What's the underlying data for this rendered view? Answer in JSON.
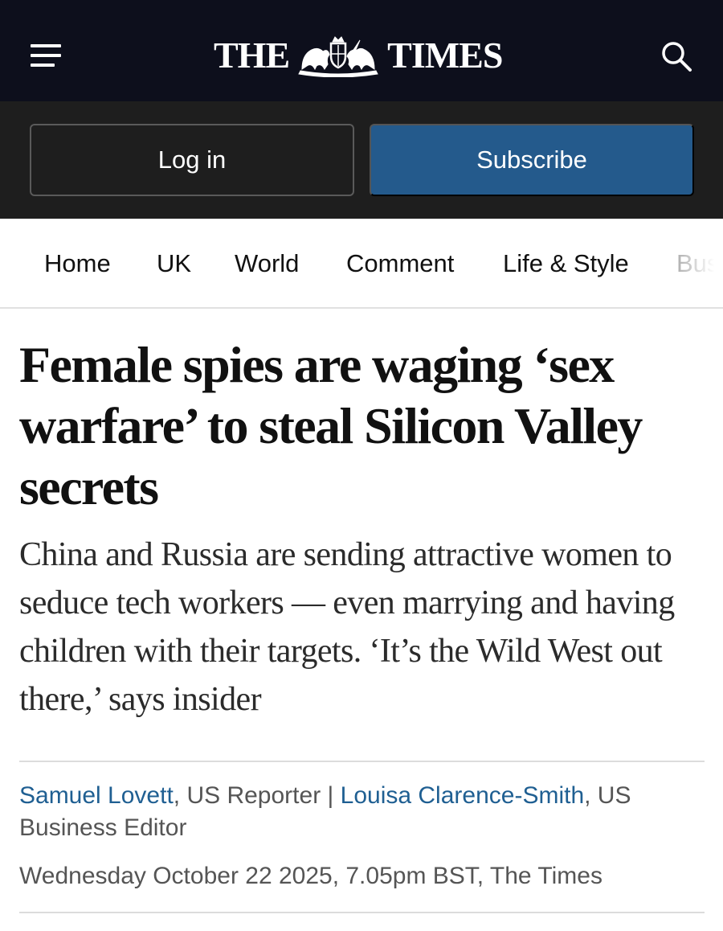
{
  "header": {
    "masthead_left": "THE",
    "masthead_right": "TIMES",
    "crest_icon": "royal-crest-icon",
    "menu_icon": "hamburger-menu-icon",
    "search_icon": "search-icon",
    "background": "#0d0f1c"
  },
  "auth": {
    "login_label": "Log in",
    "subscribe_label": "Subscribe",
    "subscribe_color": "#245a8c"
  },
  "nav": {
    "items": [
      "Home",
      "UK",
      "World",
      "Comment",
      "Life & Style",
      "Bus"
    ]
  },
  "article": {
    "headline": "Female spies are waging ‘sex warfare’ to steal Silicon Valley secrets",
    "standfirst": "China and Russia are sending attractive women to seduce tech workers — even marrying and having children with their targets. ‘It’s the Wild West out there,’ says insider",
    "byline": {
      "author1": "Samuel Lovett",
      "role1": ", US Reporter | ",
      "author2": "Louisa Clarence-Smith",
      "role2": ", US Business Editor"
    },
    "dateline": "Wednesday October 22 2025, 7.05pm BST, The Times"
  }
}
